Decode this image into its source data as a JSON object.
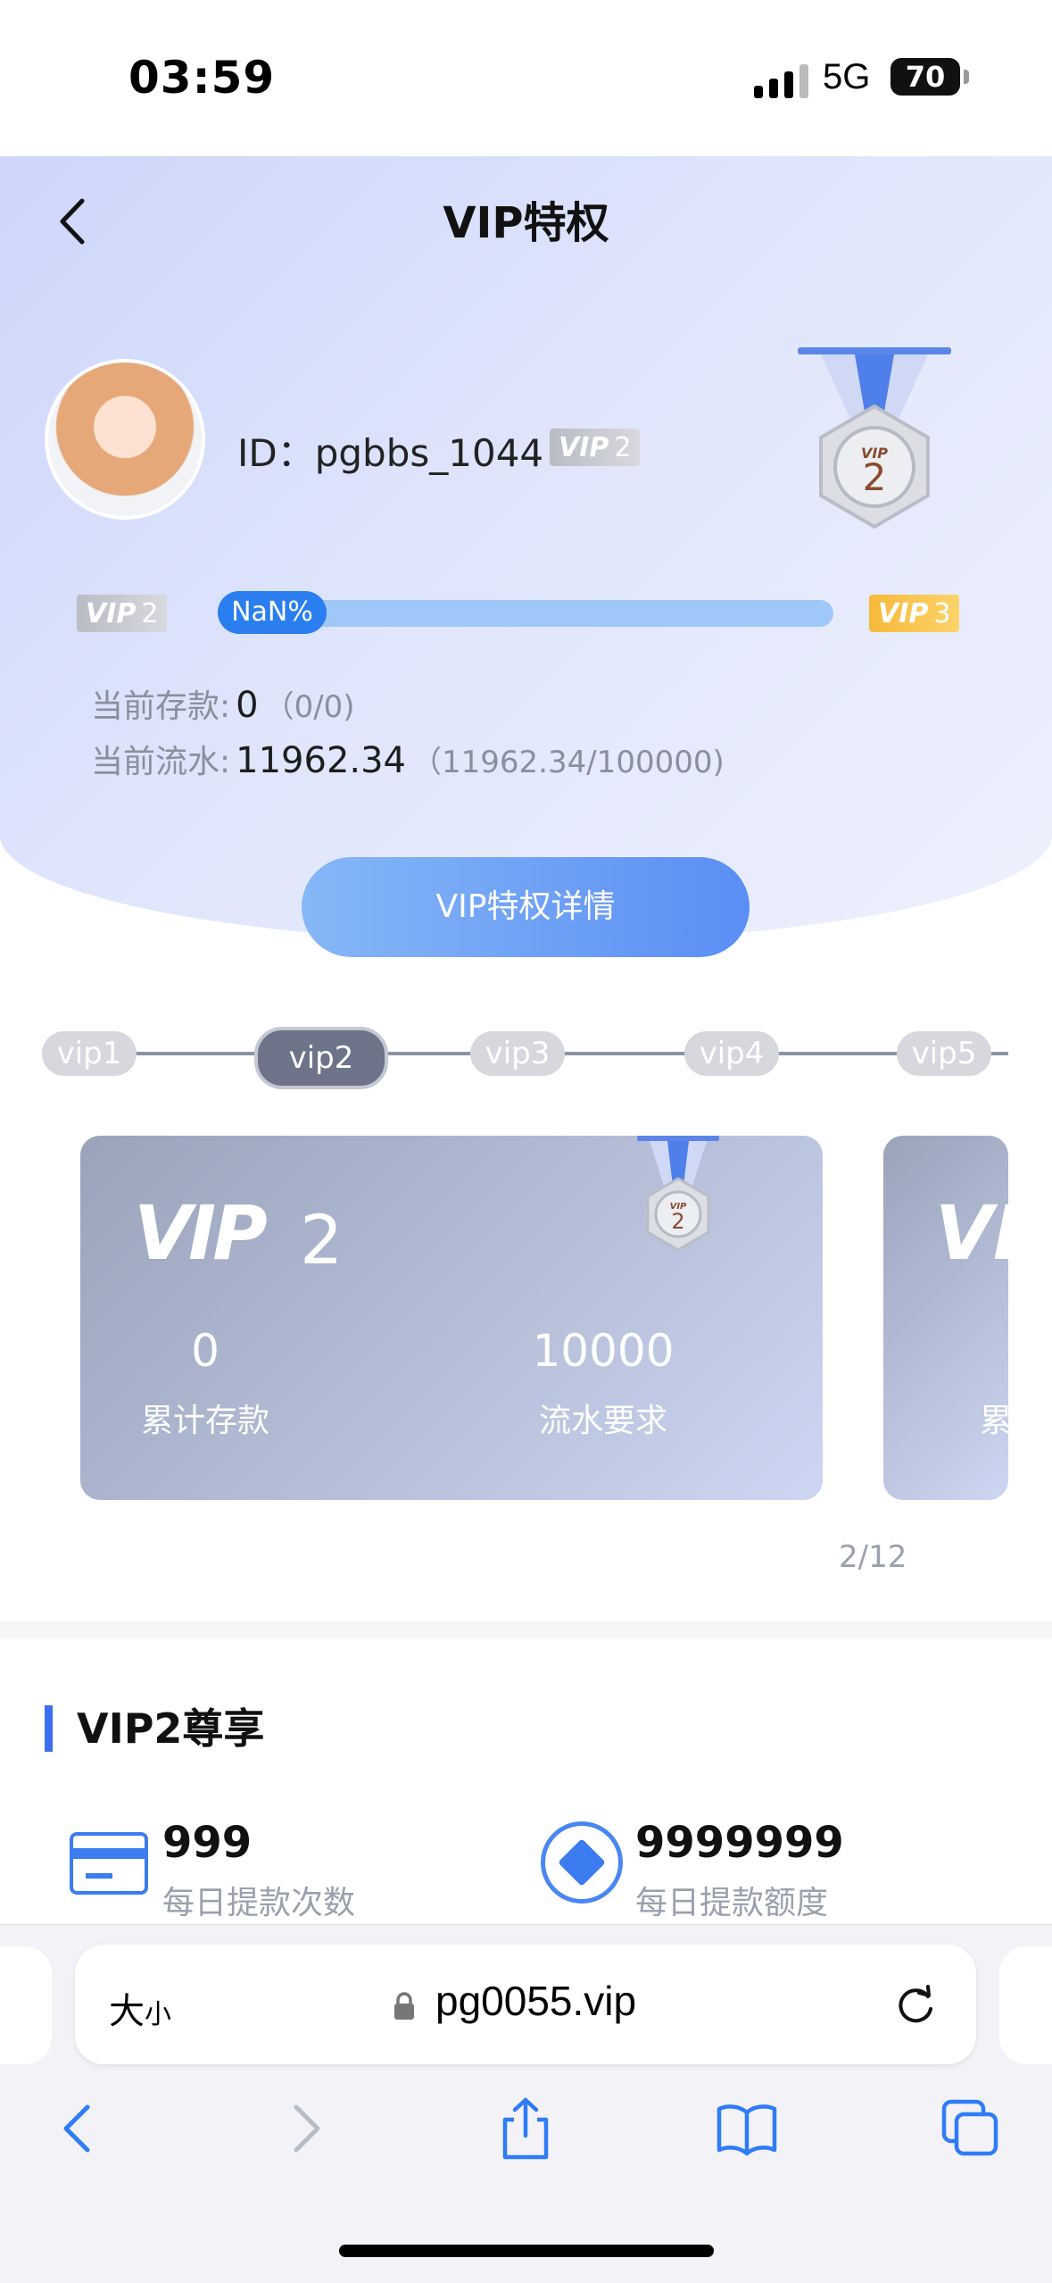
{
  "status_bar": {
    "time": "03:59",
    "network": "5G",
    "battery": "70"
  },
  "header": {
    "title": "VIP特权"
  },
  "profile": {
    "id_label": "ID：",
    "id_value": "pgbbs_1044",
    "vip_tag": "VIP",
    "vip_level": "2"
  },
  "progress": {
    "label": "NaN%",
    "from_tag": "VIP",
    "from_level": "2",
    "to_tag": "VIP",
    "to_level": "3"
  },
  "stats": {
    "deposit_label": "当前存款:",
    "deposit_value": "0",
    "deposit_sub": "（0/0)",
    "turnover_label": "当前流水:",
    "turnover_value": "11962.34",
    "turnover_sub": "（11962.34/100000)"
  },
  "details_button": "VIP特权详情",
  "levels": [
    "vip1",
    "vip2",
    "vip3",
    "vip4",
    "vip5"
  ],
  "active_level_index": 1,
  "card": {
    "vip_text": "VIP",
    "level": "2",
    "deposit_value": "0",
    "deposit_label": "累计存款",
    "turnover_value": "10000",
    "turnover_label": "流水要求"
  },
  "peek_card": {
    "vip_text": "VI",
    "label": "累"
  },
  "pager": "2/12",
  "section": {
    "title": "VIP2尊享"
  },
  "perks": [
    {
      "value": "999",
      "label": "每日提款次数",
      "icon": "card-icon"
    },
    {
      "value": "9999999",
      "label": "每日提款额度",
      "icon": "diamond-icon"
    }
  ],
  "browser": {
    "text_size": "大",
    "text_size_small": "小",
    "url": "pg0055.vip"
  },
  "colors": {
    "accent": "#3b7cf0",
    "progress": "#2a7ef0",
    "gold": "#f8b93a"
  }
}
